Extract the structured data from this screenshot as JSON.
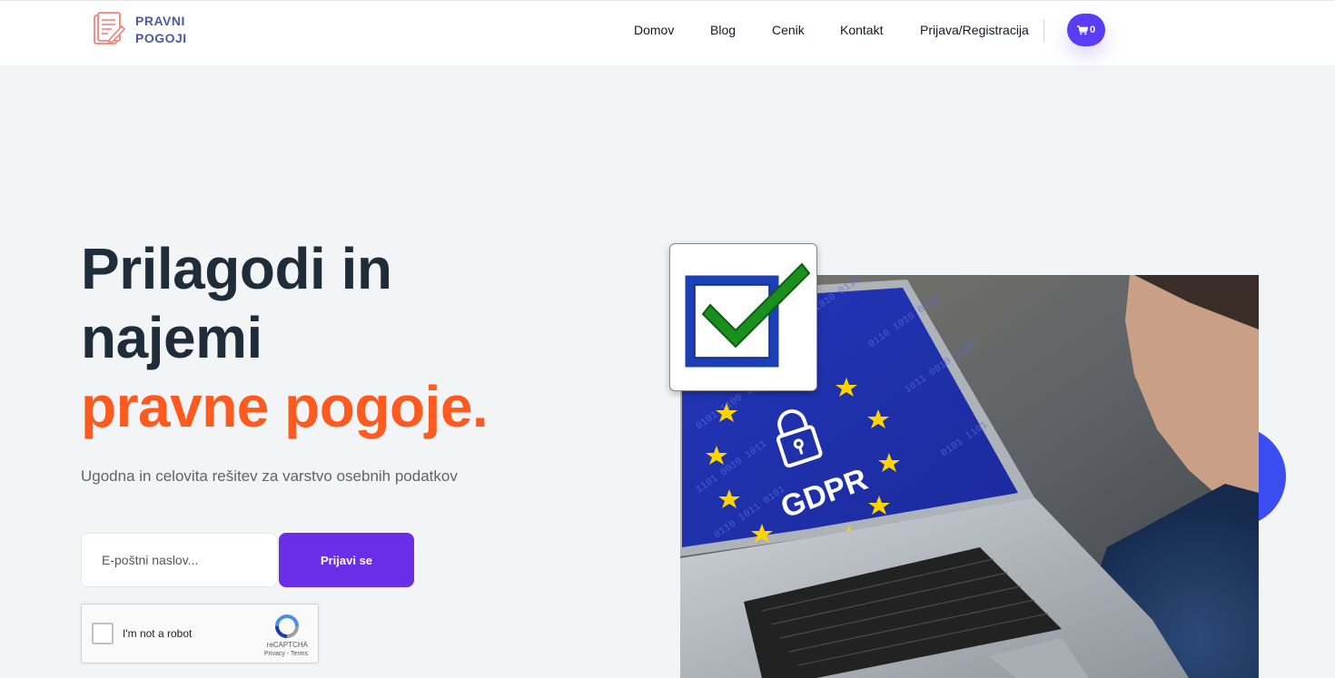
{
  "header": {
    "logo_line1": "PRAVNI",
    "logo_line2": "POGOJI",
    "nav": [
      {
        "label": "Domov"
      },
      {
        "label": "Blog"
      },
      {
        "label": "Cenik"
      },
      {
        "label": "Kontakt"
      },
      {
        "label": "Prijava/Registracija"
      }
    ],
    "cart_count": "0"
  },
  "hero": {
    "title_line1": "Prilagodi in",
    "title_line2": "najemi",
    "title_accent": "pravne pogoje.",
    "subtitle": "Ugodna in celovita rešitev za varstvo osebnih podatkov",
    "email_placeholder": "E-poštni naslov...",
    "submit_label": "Prijavi se"
  },
  "recaptcha": {
    "label": "I'm not a robot",
    "brand": "reCAPTCHA",
    "terms": "Privacy - Terms"
  },
  "image": {
    "screen_text": "GDPR"
  },
  "colors": {
    "accent_orange": "#fd5a1f",
    "button_purple": "#6a2ee8",
    "cart_purple": "#5b3cf5",
    "heading_dark": "#1f2d3a",
    "logo_blue": "#4b5aa0",
    "eu_blue": "#2c3fbf",
    "star_yellow": "#ffd400"
  },
  "icons": [
    "document-pen-logo-icon",
    "cart-icon",
    "recaptcha-icon",
    "checkmark-icon",
    "padlock-icon",
    "eu-star-icon"
  ]
}
